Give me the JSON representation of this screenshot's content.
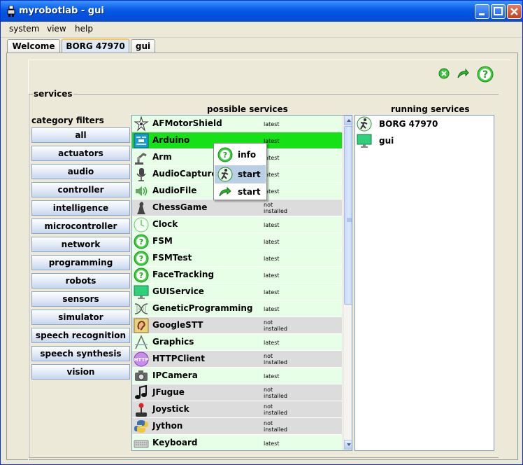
{
  "window": {
    "title": "myrobotlab - gui"
  },
  "menu": [
    "system",
    "view",
    "help"
  ],
  "tabs": [
    "Welcome",
    "BORG 47970",
    "gui"
  ],
  "panel": {
    "services_label": "services",
    "category_filters_label": "category filters",
    "possible_services_label": "possible services",
    "running_services_label": "running services"
  },
  "categories": [
    "all",
    "actuators",
    "audio",
    "controller",
    "intelligence",
    "microcontroller",
    "network",
    "programming",
    "robots",
    "sensors",
    "simulator",
    "speech recognition",
    "speech synthesis",
    "vision"
  ],
  "possible_services": [
    {
      "name": "AFMotorShield",
      "status": "latest",
      "icon": "adafruit-star-icon"
    },
    {
      "name": "Arduino",
      "status": "latest",
      "icon": "arduino-icon"
    },
    {
      "name": "Arm",
      "status": "latest",
      "icon": "robot-arm-icon"
    },
    {
      "name": "AudioCapture",
      "status": "latest",
      "icon": "microphone-icon"
    },
    {
      "name": "AudioFile",
      "status": "latest",
      "icon": "speaker-icon"
    },
    {
      "name": "ChessGame",
      "status": "not\ninstalled",
      "icon": "chess-icon"
    },
    {
      "name": "Clock",
      "status": "latest",
      "icon": "clock-icon"
    },
    {
      "name": "FSM",
      "status": "latest",
      "icon": "question-icon"
    },
    {
      "name": "FSMTest",
      "status": "latest",
      "icon": "question-icon"
    },
    {
      "name": "FaceTracking",
      "status": "latest",
      "icon": "question-icon"
    },
    {
      "name": "GUIService",
      "status": "latest",
      "icon": "monitor-icon"
    },
    {
      "name": "GeneticProgramming",
      "status": "latest",
      "icon": "dna-icon"
    },
    {
      "name": "GoogleSTT",
      "status": "not\ninstalled",
      "icon": "ear-icon"
    },
    {
      "name": "Graphics",
      "status": "latest",
      "icon": "drafting-icon"
    },
    {
      "name": "HTTPClient",
      "status": "not\ninstalled",
      "icon": "http-icon"
    },
    {
      "name": "IPCamera",
      "status": "latest",
      "icon": "camera-icon"
    },
    {
      "name": "JFugue",
      "status": "not\ninstalled",
      "icon": "music-note-icon"
    },
    {
      "name": "Joystick",
      "status": "not\ninstalled",
      "icon": "joystick-icon"
    },
    {
      "name": "Jython",
      "status": "not\ninstalled",
      "icon": "python-icon"
    },
    {
      "name": "Keyboard",
      "status": "latest",
      "icon": "keyboard-icon"
    }
  ],
  "running_services": [
    {
      "name": "BORG 47970",
      "icon": "runner-icon"
    },
    {
      "name": "gui",
      "icon": "monitor-icon"
    }
  ],
  "popup_menu": [
    {
      "label": "info",
      "icon": "question-icon"
    },
    {
      "label": "start",
      "icon": "runner-icon"
    },
    {
      "label": "start",
      "icon": "refresh-arrow-icon"
    }
  ],
  "colors": {
    "selected_row": "#16e016",
    "installed_row": "#e6ffe6",
    "not_installed_row": "#dcdcdc"
  }
}
